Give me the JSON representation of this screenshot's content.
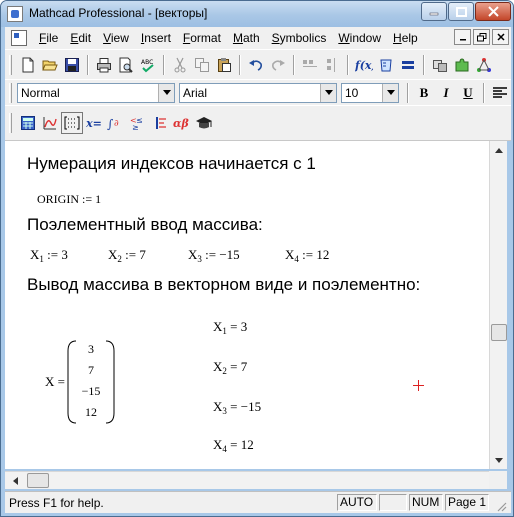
{
  "window": {
    "title": "Mathcad Professional - [векторы]"
  },
  "menubar": {
    "items": [
      "File",
      "Edit",
      "View",
      "Insert",
      "Format",
      "Math",
      "Symbolics",
      "Window",
      "Help"
    ]
  },
  "format_toolbar": {
    "style": "Normal",
    "font": "Arial",
    "size": "10",
    "bold": "B",
    "italic": "I",
    "underline": "U"
  },
  "math_toolbar": {
    "eval_label": "x="
  },
  "document": {
    "heading1": "Нумерация индексов начинается с 1",
    "origin_name": "ORIGIN",
    "origin_op": " := ",
    "origin_value": "1",
    "heading2": "Поэлементный ввод массива:",
    "assignments": [
      {
        "base": "X",
        "sub": "1",
        "op": " := ",
        "value": "3"
      },
      {
        "base": "X",
        "sub": "2",
        "op": " := ",
        "value": "7"
      },
      {
        "base": "X",
        "sub": "3",
        "op": " := ",
        "value": "−15"
      },
      {
        "base": "X",
        "sub": "4",
        "op": " := ",
        "value": "12"
      }
    ],
    "heading3": "Вывод массива в векторном виде и поэлементно:",
    "vector_label": "X = ",
    "vector_values": [
      "3",
      "7",
      "−15",
      "12"
    ],
    "results": [
      {
        "base": "X",
        "sub": "1",
        "op": " = ",
        "value": "3"
      },
      {
        "base": "X",
        "sub": "2",
        "op": " = ",
        "value": "7"
      },
      {
        "base": "X",
        "sub": "3",
        "op": " = ",
        "value": "−15"
      },
      {
        "base": "X",
        "sub": "4",
        "op": " = ",
        "value": "12"
      }
    ]
  },
  "statusbar": {
    "help": "Press F1 for help.",
    "mode": "AUTO",
    "num": "NUM",
    "page": "Page 1"
  }
}
